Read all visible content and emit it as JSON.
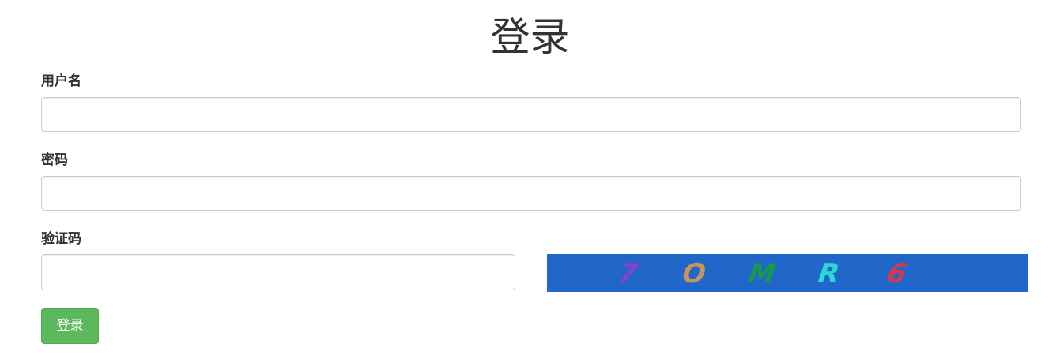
{
  "page": {
    "title": "登录"
  },
  "form": {
    "username_label": "用户名",
    "username_value": "",
    "password_label": "密码",
    "password_value": "",
    "captcha_label": "验证码",
    "captcha_value": "",
    "submit_label": "登录"
  },
  "captcha_image": {
    "background": "#2166c9",
    "characters": [
      {
        "char": "7",
        "color": "#8a3fd0"
      },
      {
        "char": "O",
        "color": "#c7955a"
      },
      {
        "char": "M",
        "color": "#17994a"
      },
      {
        "char": "R",
        "color": "#2fd6d8"
      },
      {
        "char": "6",
        "color": "#d8384a"
      }
    ]
  },
  "colors": {
    "primary_button": "#5cb85c",
    "text": "#333333",
    "input_border": "#cccccc"
  }
}
